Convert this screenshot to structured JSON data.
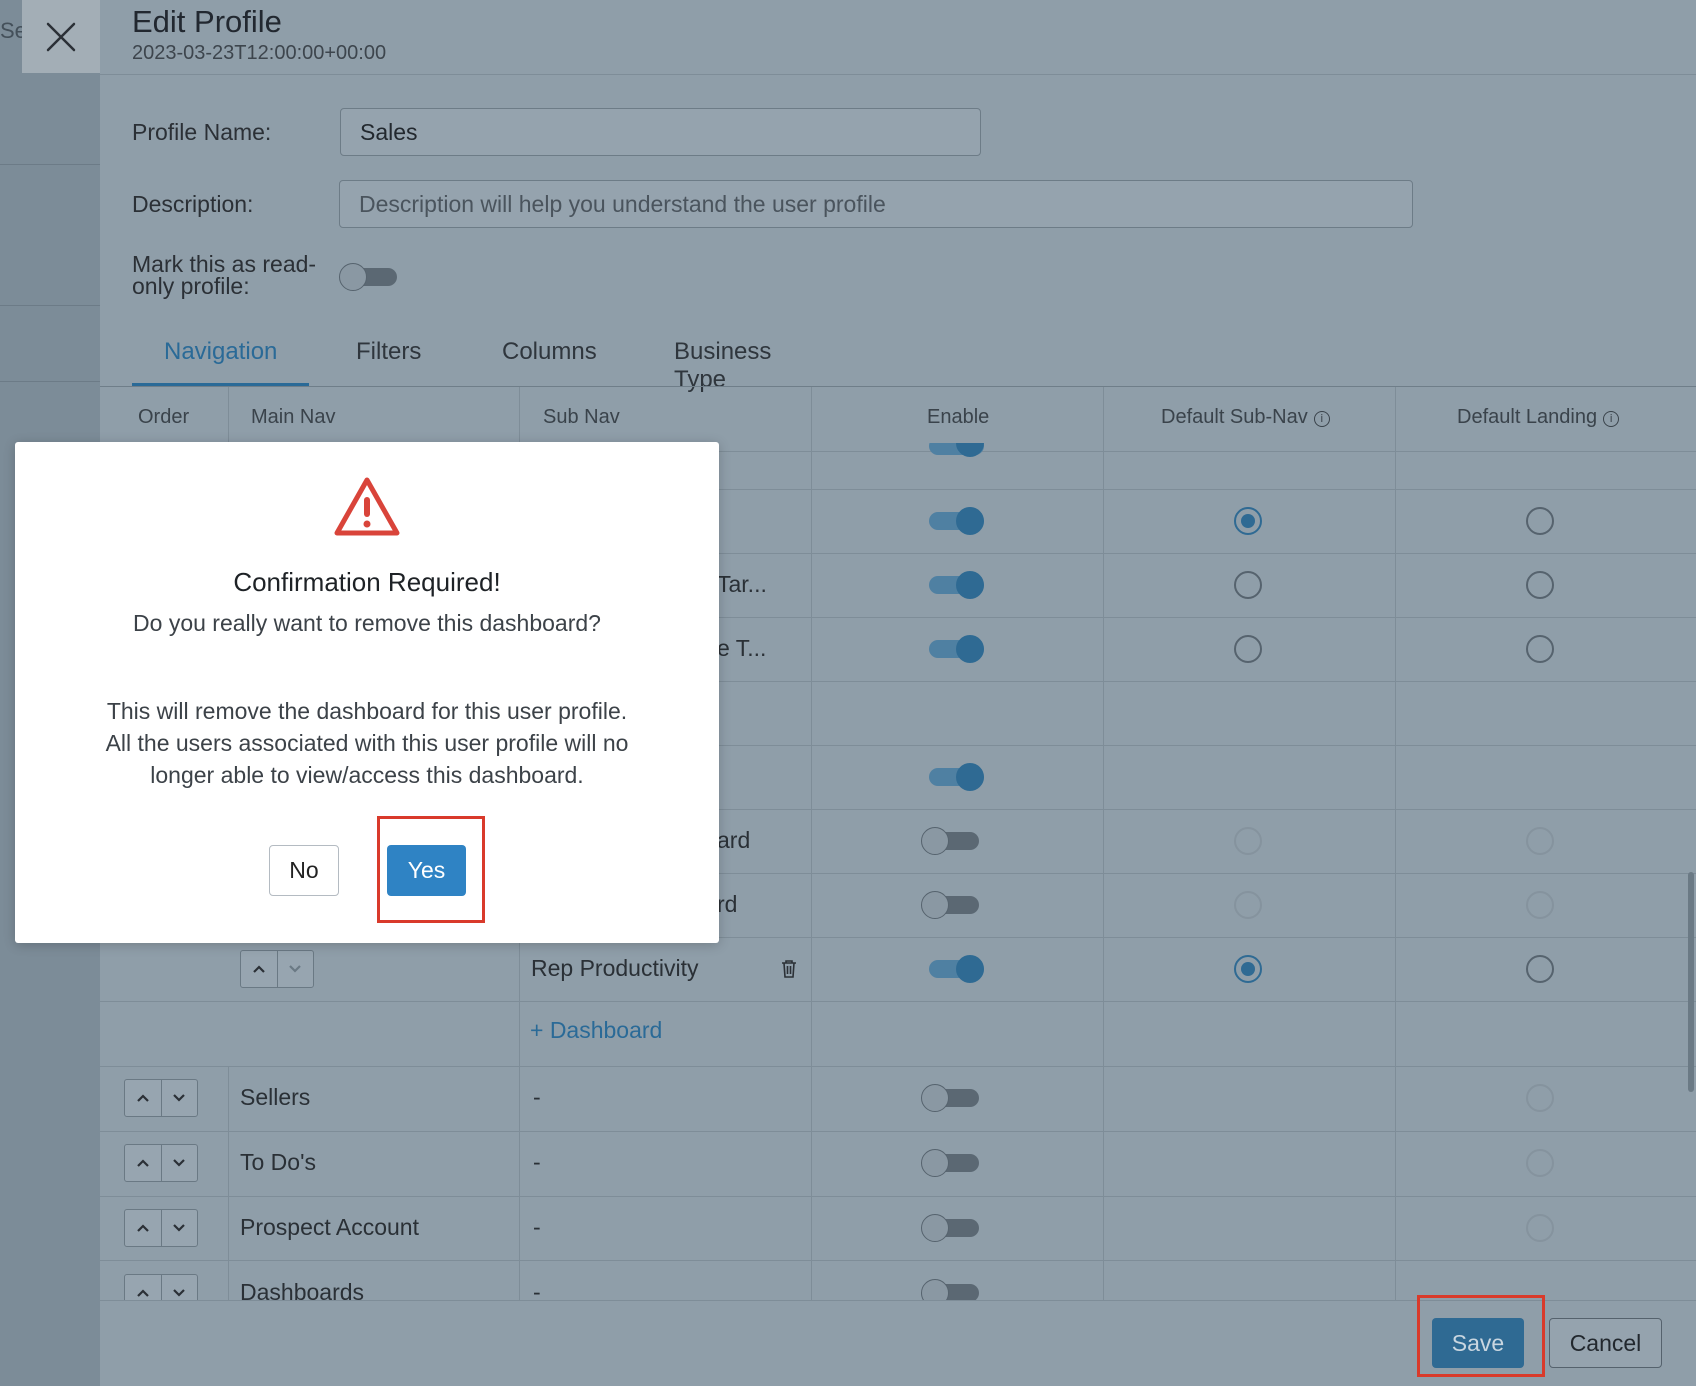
{
  "background": {
    "search_fragment": "Sea"
  },
  "drawer": {
    "title": "Edit Profile",
    "subtitle": "2023-03-23T12:00:00+00:00"
  },
  "form": {
    "profile_name_label": "Profile Name:",
    "profile_name_value": "Sales",
    "description_label": "Description:",
    "description_placeholder": "Description will help you understand the user profile",
    "readonly_label_line1": "Mark this as read-",
    "readonly_label_line2": "only profile:",
    "readonly_enabled": false
  },
  "tabs": [
    {
      "label": "Navigation",
      "active": true
    },
    {
      "label": "Filters",
      "active": false
    },
    {
      "label": "Columns",
      "active": false
    },
    {
      "label": "Business Type",
      "active": false
    }
  ],
  "table": {
    "headers": {
      "order": "Order",
      "main_nav": "Main Nav",
      "sub_nav": "Sub Nav",
      "enable": "Enable",
      "default_sub_nav": "Default Sub-Nav",
      "default_landing": "Default Landing"
    },
    "partial_sub_nav": [
      "Tar...",
      "e T...",
      "ard",
      "rd"
    ],
    "rep_productivity": "Rep Productivity",
    "add_dashboard": "+ Dashboard",
    "rows": [
      {
        "main_nav": "Sellers",
        "sub_nav": "-"
      },
      {
        "main_nav": "To Do's",
        "sub_nav": "-"
      },
      {
        "main_nav": "Prospect Account",
        "sub_nav": "-"
      },
      {
        "main_nav": "Dashboards",
        "sub_nav": "-"
      }
    ]
  },
  "footer": {
    "save_label": "Save",
    "cancel_label": "Cancel"
  },
  "modal": {
    "title": "Confirmation Required!",
    "question": "Do you really want to remove this dashboard?",
    "body_line1": "This will remove the dashboard for this user profile.",
    "body_line2": "All the users associated with this user profile will no",
    "body_line3": "longer able to view/access this dashboard.",
    "no_label": "No",
    "yes_label": "Yes"
  },
  "colors": {
    "accent": "#2f6a93",
    "modal_primary": "#2f83c4",
    "highlight": "#d93a2b",
    "warning": "#d9443a"
  }
}
